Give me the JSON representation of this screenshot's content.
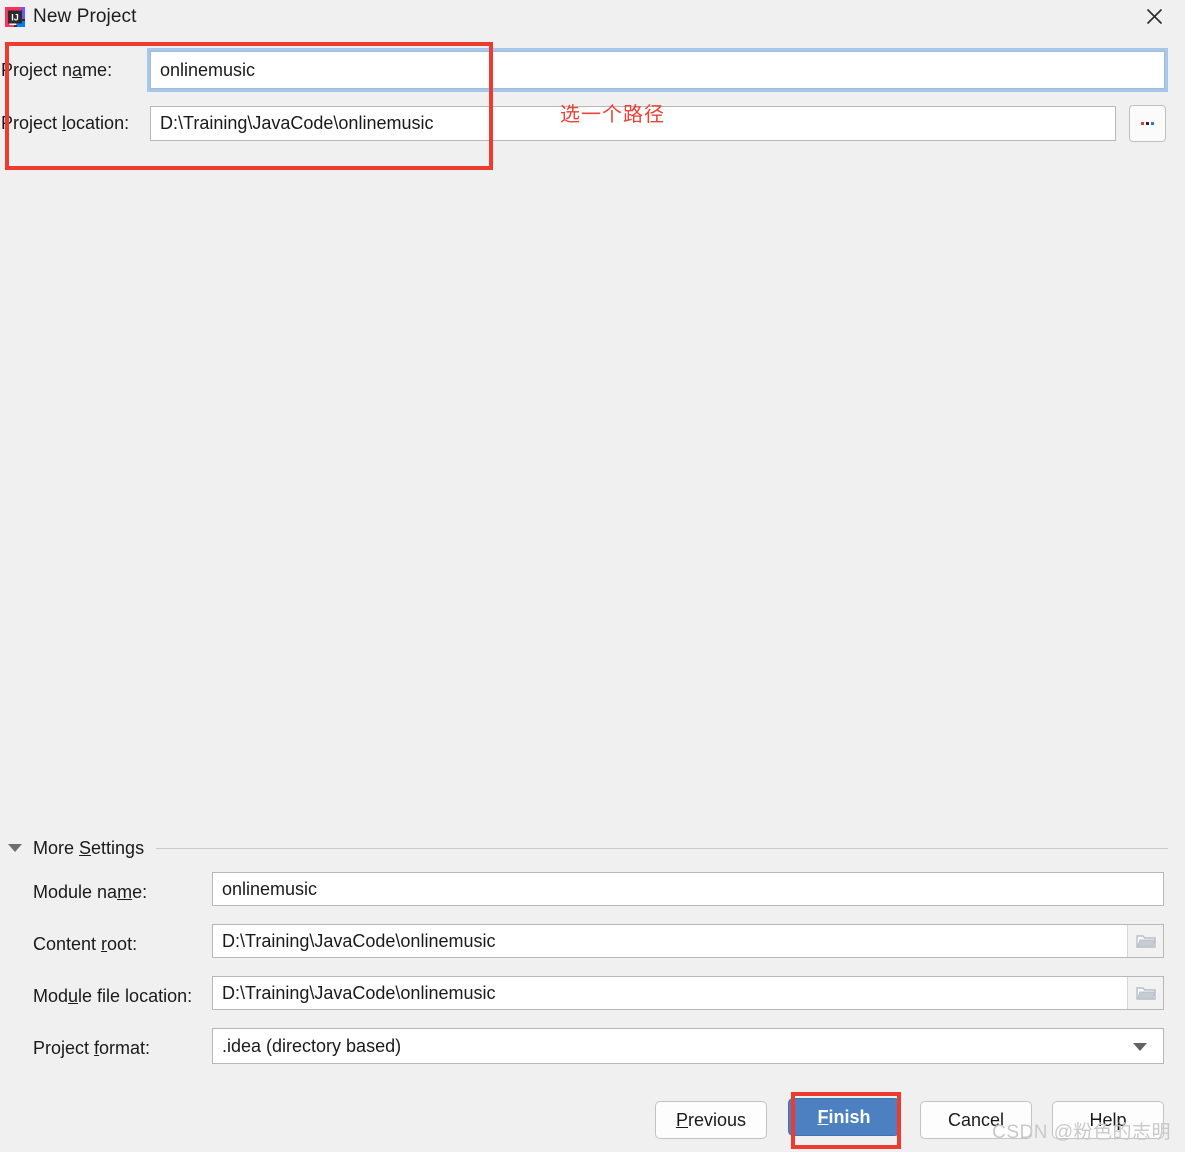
{
  "window": {
    "title": "New Project",
    "app_icon": "intellij-idea-icon",
    "close_icon": "close-icon"
  },
  "top_form": {
    "project_name": {
      "label_pre": "Project n",
      "label_mnemonic": "a",
      "label_post": "me:",
      "value": "onlinemusic"
    },
    "project_location": {
      "label_pre": "Project ",
      "label_mnemonic": "l",
      "label_post": "ocation:",
      "value": "D:\\Training\\JavaCode\\onlinemusic"
    },
    "browse_button": {
      "label": "...",
      "icon": "ellipsis-icon"
    }
  },
  "annotations": {
    "path_note": "选一个路径",
    "highlight_color": "#ee3b2f"
  },
  "more_settings": {
    "label_pre": "More ",
    "label_mnemonic": "S",
    "label_post": "ettings",
    "label": "More Settings",
    "expanded": true,
    "collapse_icon": "triangle-down-icon",
    "rows": [
      {
        "label_pre": "Module na",
        "label_mnemonic": "m",
        "label_post": "e:",
        "value": "onlinemusic",
        "control": "text",
        "name": "module-name"
      },
      {
        "label_pre": "Content ",
        "label_mnemonic": "r",
        "label_post": "oot:",
        "value": "D:\\Training\\JavaCode\\onlinemusic",
        "control": "text-with-browse",
        "icon": "folder-icon",
        "name": "content-root"
      },
      {
        "label_pre": "Mod",
        "label_mnemonic": "u",
        "label_post": "le file location:",
        "value": "D:\\Training\\JavaCode\\onlinemusic",
        "control": "text-with-browse",
        "icon": "folder-icon",
        "name": "module-file-location"
      },
      {
        "label_pre": "Project ",
        "label_mnemonic": "f",
        "label_post": "ormat:",
        "value": ".idea (directory based)",
        "control": "combobox",
        "icon": "chevron-down-icon",
        "name": "project-format"
      }
    ]
  },
  "buttons": {
    "previous": {
      "pre": "",
      "mnemonic": "P",
      "post": "revious"
    },
    "finish": {
      "pre": "",
      "mnemonic": "F",
      "post": "inish",
      "primary": true,
      "highlighted": true
    },
    "cancel": {
      "pre": "Cancel",
      "mnemonic": "",
      "post": ""
    },
    "help": {
      "pre": "Help",
      "mnemonic": "",
      "post": ""
    }
  },
  "watermark": "CSDN @粉色的志明",
  "colors": {
    "dialog_bg": "#f0f0f0",
    "primary_button": "#4d80c0",
    "focus_ring": "#a8c6e8",
    "annotation_red": "#ee3b2f"
  }
}
